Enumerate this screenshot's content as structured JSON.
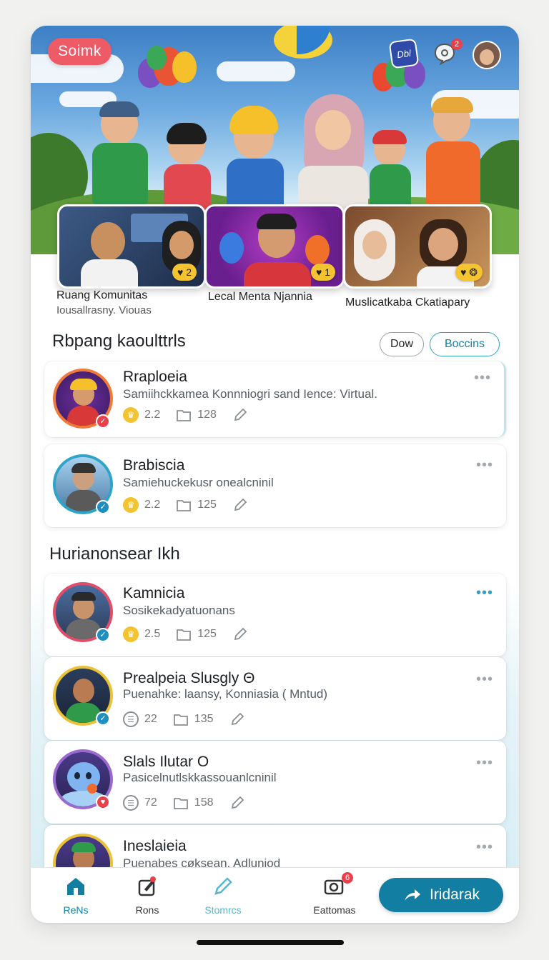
{
  "header": {
    "brand": "Soimk",
    "chat_icon_label": "Dbl",
    "notification_count": "2"
  },
  "featured": [
    {
      "label": "Ruang Komunitas",
      "sub": "Iousallrasny.  Viouas",
      "count": "2"
    },
    {
      "label": "Lecal Menta Njannia",
      "sub": "",
      "count": "1"
    },
    {
      "label": "Muslicatkaba Ckatiapary",
      "sub": "",
      "count": ""
    }
  ],
  "section1": {
    "title": "Rbpang kaoulttrls",
    "chip_a": "Dow",
    "chip_b": "Boccins"
  },
  "section2": {
    "title": "Hurianonsear Ikh"
  },
  "posts": [
    {
      "name": "Rraploeia",
      "desc": "Samiihckkamea Konnniogri sand Ience: Virtual.",
      "likes": "2.2",
      "files": "128"
    },
    {
      "name": "Brabiscia",
      "desc": "Samiehuckekusr onealcninil",
      "likes": "2.2",
      "files": "125"
    },
    {
      "name": "Kamnicia",
      "desc": "Sosikekadyatuonans",
      "likes": "2.5",
      "files": "125"
    },
    {
      "name": "Prealpeia Slusgly Θ",
      "desc": "Puenahke: laansy, Konniasia ( Mntud)",
      "likes": "22",
      "files": "135"
    },
    {
      "name": "Slals Ilutar O",
      "desc": "Pasicelnutlskkassouanlcninil",
      "likes": "72",
      "files": "158"
    },
    {
      "name": "Ineslaieia",
      "desc": "Puenabes cøksean. Adluniod",
      "likes": "",
      "files": ""
    }
  ],
  "nav": {
    "home": "ReNs",
    "rons": "Rons",
    "stories": "Stomrcs",
    "eattomas": "Eattomas",
    "eattomas_badge": "6",
    "cta": "Iridarak"
  },
  "colors": {
    "accent": "#127ea2",
    "brand_pill": "#ef5a67",
    "cyan_chip": "#2fa4c9",
    "badge": "#e8404c",
    "gold": "#f4c430"
  }
}
